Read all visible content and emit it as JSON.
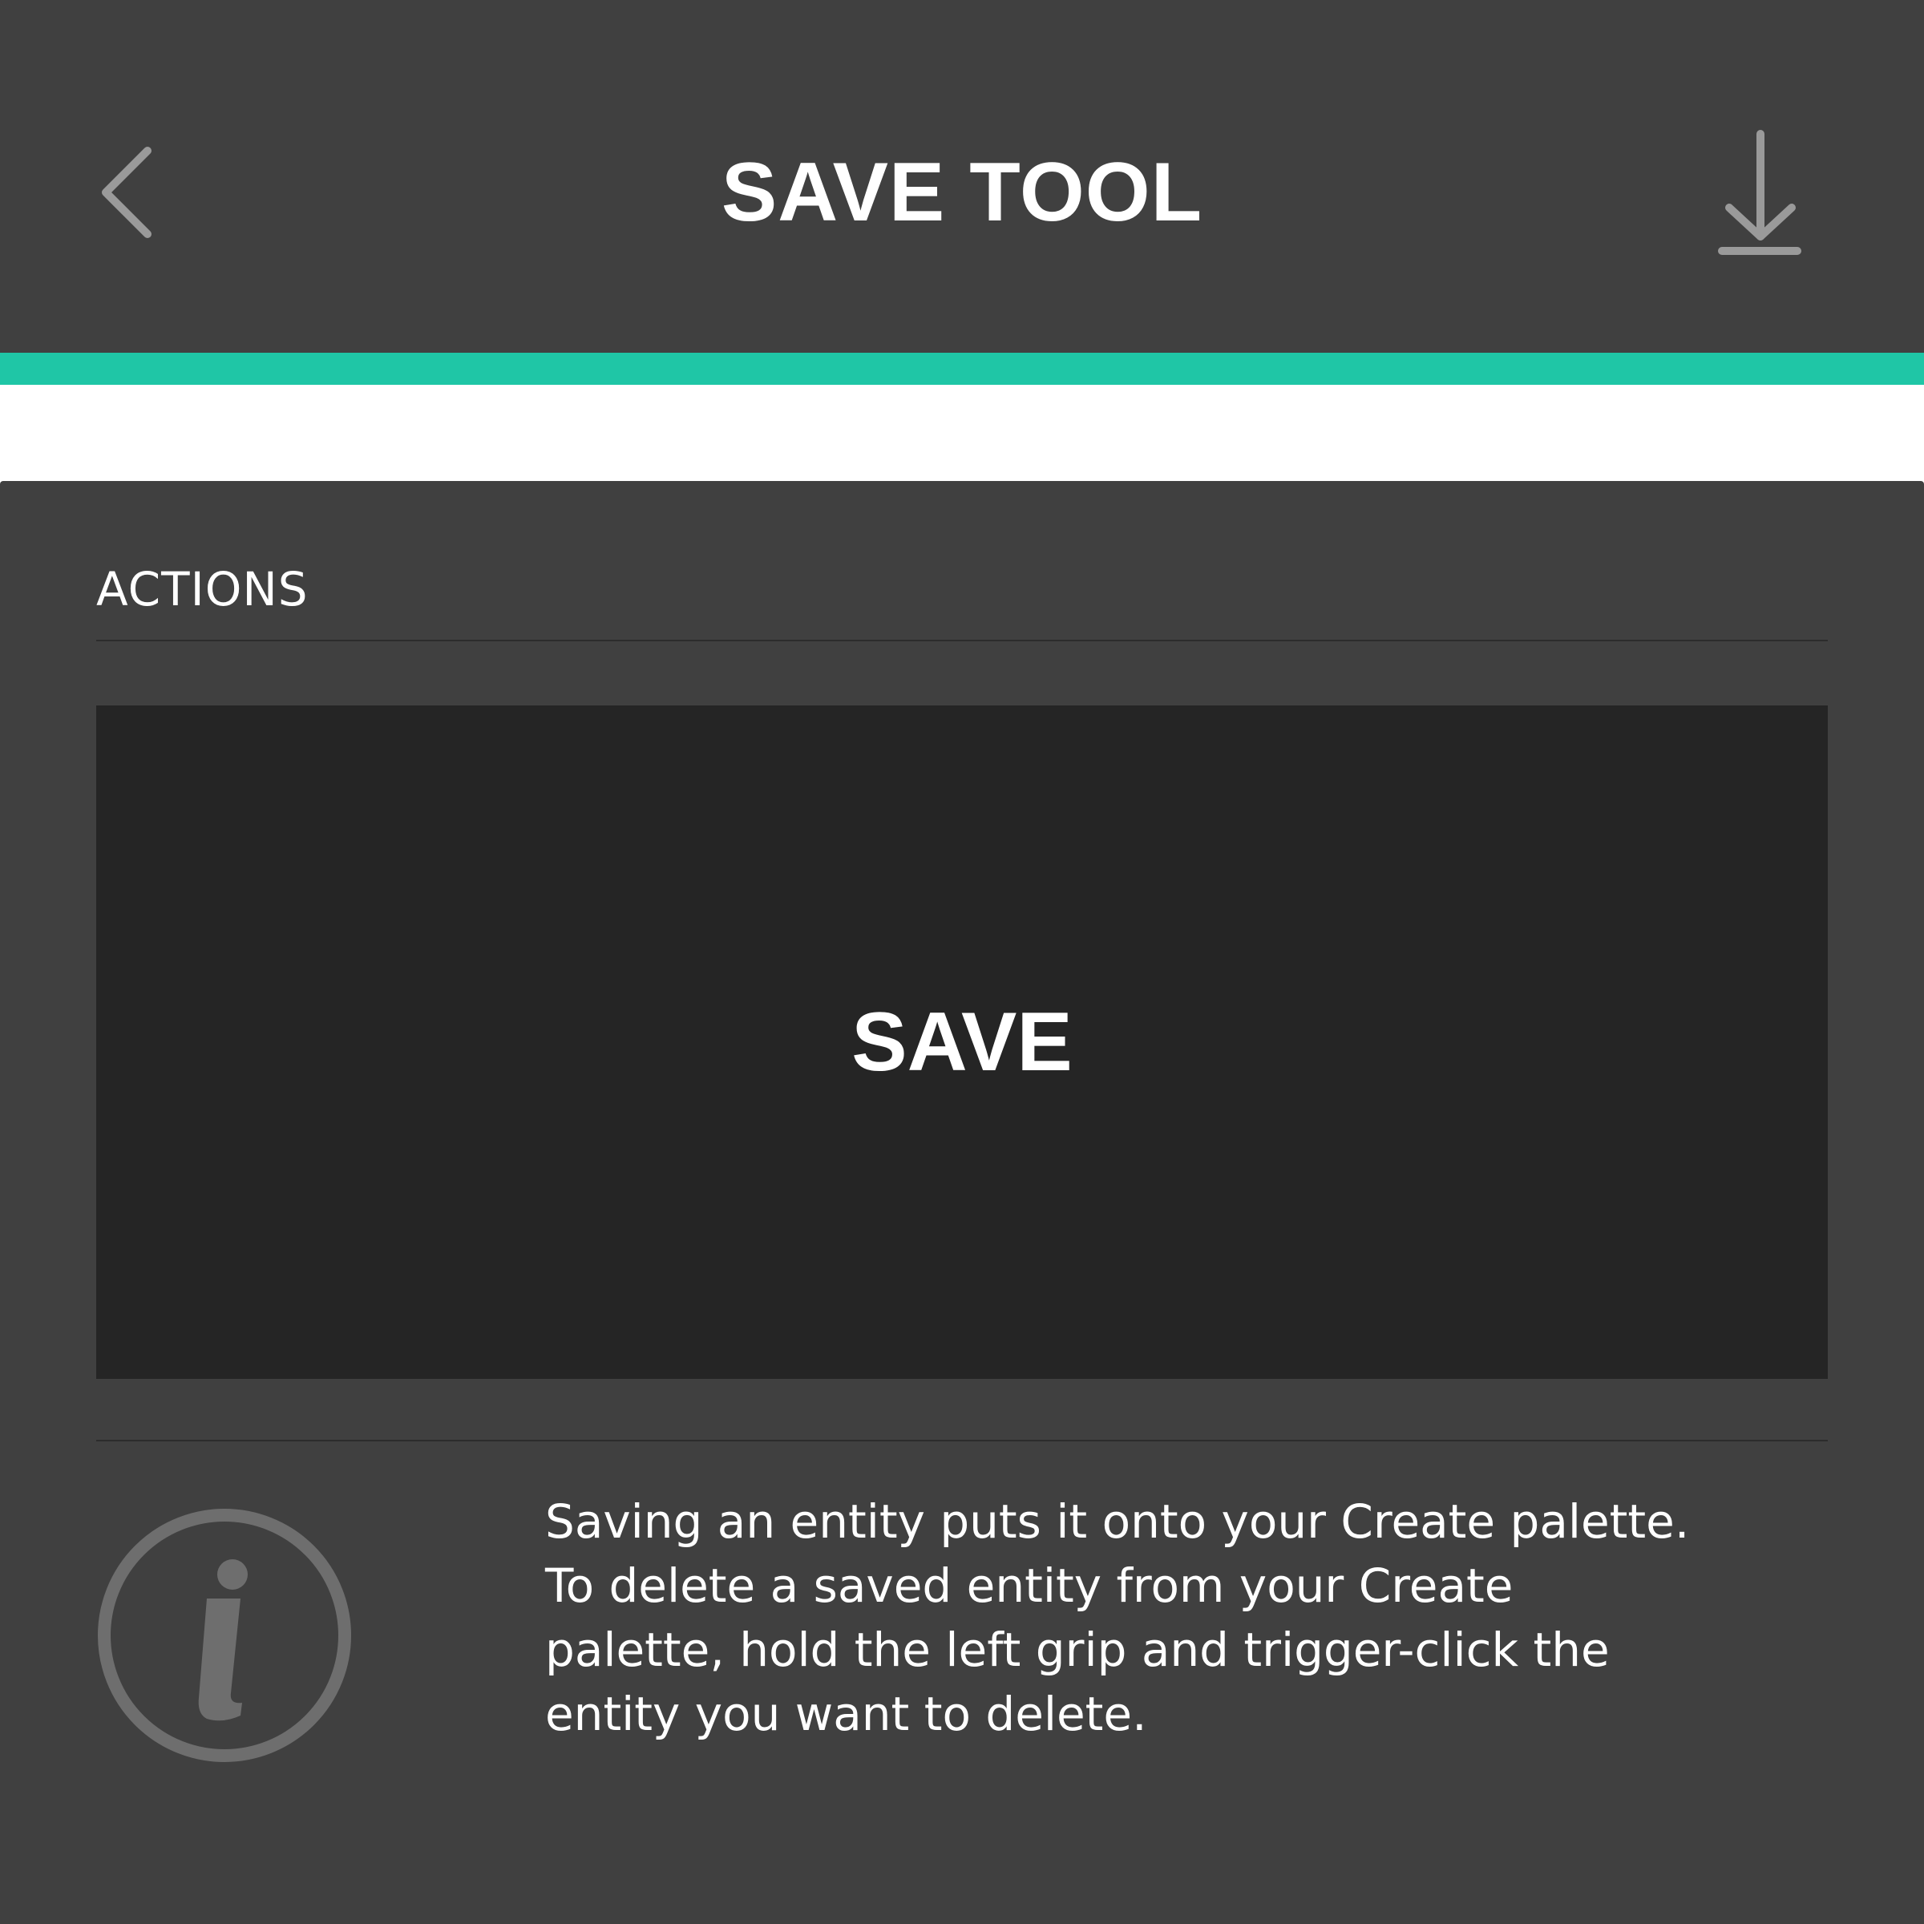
{
  "header": {
    "title": "SAVE TOOL",
    "back_icon": "chevron-left-icon",
    "download_icon": "download-icon"
  },
  "colors": {
    "header_bg": "#404040",
    "accent": "#1fc6a6",
    "panel_bg": "#404040",
    "button_bg": "#252525",
    "icon_gray": "#9a9a9a",
    "info_icon_gray": "#6e6e6e"
  },
  "actions": {
    "section_label": "ACTIONS",
    "save_label": "SAVE"
  },
  "info": {
    "icon": "info-icon",
    "text": "Saving an entity puts it onto your Create palette.\nTo delete a saved entity from your Create\npalette, hold the left grip and trigger-click the\nentity you want to delete."
  }
}
